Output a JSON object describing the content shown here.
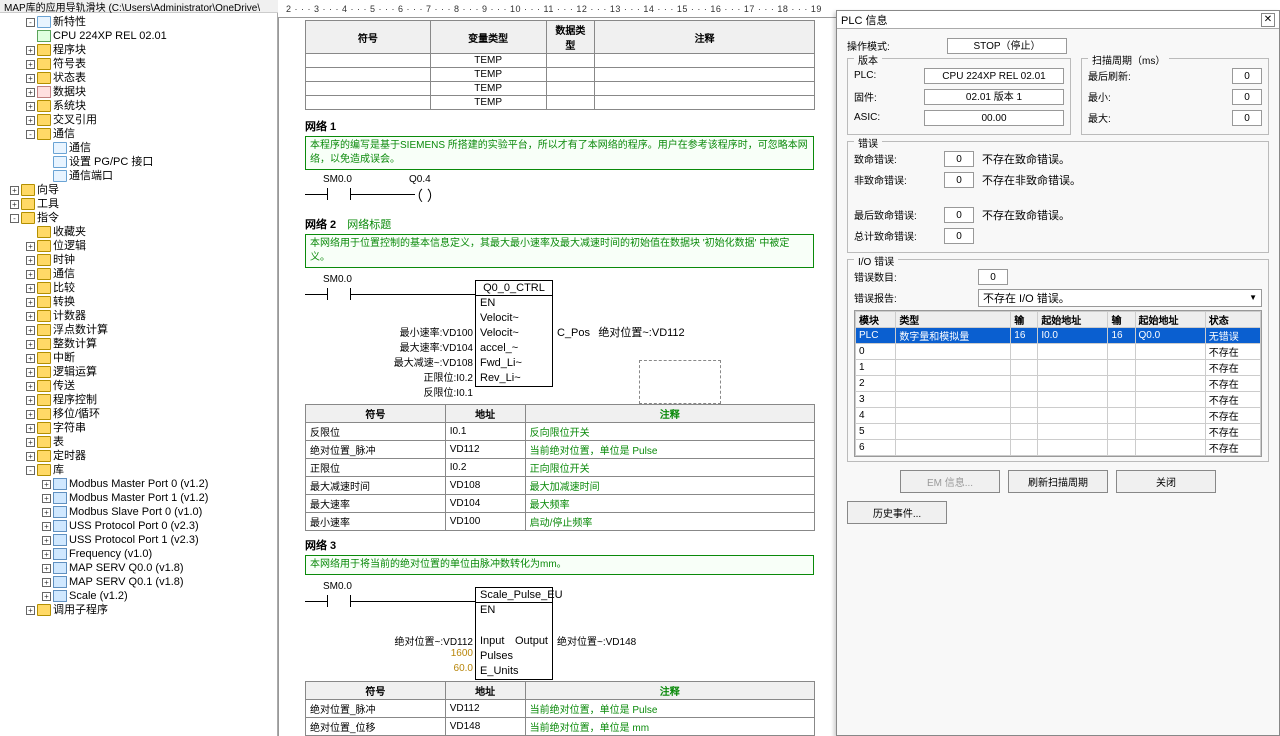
{
  "topbar": {
    "title": "MAP库的应用导轨滑块 (C:\\Users\\Administrator\\OneDrive\\"
  },
  "ruler": "2  · · · 3 · · · 4 · · · 5 · · · 6 · · · 7 · · · 8 · · · 9 · · · 10 · · · 11 · · · 12 · · · 13 · · · 14 · · · 15 · · · 16 · · · 17 · · · 18 · · · 19",
  "tree": [
    {
      "ind": 1,
      "exp": "-",
      "icon": "file",
      "label": "新特性"
    },
    {
      "ind": 1,
      "exp": " ",
      "icon": "chip",
      "label": "CPU 224XP REL 02.01"
    },
    {
      "ind": 1,
      "exp": "+",
      "icon": "folder",
      "label": "程序块"
    },
    {
      "ind": 1,
      "exp": "+",
      "icon": "folder",
      "label": "符号表"
    },
    {
      "ind": 1,
      "exp": "+",
      "icon": "folder",
      "label": "状态表"
    },
    {
      "ind": 1,
      "exp": "+",
      "icon": "block",
      "label": "数据块"
    },
    {
      "ind": 1,
      "exp": "+",
      "icon": "folder",
      "label": "系统块"
    },
    {
      "ind": 1,
      "exp": "+",
      "icon": "folder",
      "label": "交叉引用"
    },
    {
      "ind": 1,
      "exp": "-",
      "icon": "folder",
      "label": "通信"
    },
    {
      "ind": 2,
      "exp": " ",
      "icon": "file",
      "label": "通信"
    },
    {
      "ind": 2,
      "exp": " ",
      "icon": "file",
      "label": "设置 PG/PC 接口"
    },
    {
      "ind": 2,
      "exp": " ",
      "icon": "file",
      "label": "通信端口"
    },
    {
      "ind": 0,
      "exp": "+",
      "icon": "folder",
      "label": "向导"
    },
    {
      "ind": 0,
      "exp": "+",
      "icon": "folder",
      "label": "工具"
    },
    {
      "ind": 0,
      "exp": "-",
      "icon": "folder",
      "label": "指令"
    },
    {
      "ind": 1,
      "exp": " ",
      "icon": "folder",
      "label": "收藏夹"
    },
    {
      "ind": 1,
      "exp": "+",
      "icon": "folder",
      "label": "位逻辑"
    },
    {
      "ind": 1,
      "exp": "+",
      "icon": "folder",
      "label": "时钟"
    },
    {
      "ind": 1,
      "exp": "+",
      "icon": "folder",
      "label": "通信"
    },
    {
      "ind": 1,
      "exp": "+",
      "icon": "folder",
      "label": "比较"
    },
    {
      "ind": 1,
      "exp": "+",
      "icon": "folder",
      "label": "转换"
    },
    {
      "ind": 1,
      "exp": "+",
      "icon": "folder",
      "label": "计数器"
    },
    {
      "ind": 1,
      "exp": "+",
      "icon": "folder",
      "label": "浮点数计算"
    },
    {
      "ind": 1,
      "exp": "+",
      "icon": "folder",
      "label": "整数计算"
    },
    {
      "ind": 1,
      "exp": "+",
      "icon": "folder",
      "label": "中断"
    },
    {
      "ind": 1,
      "exp": "+",
      "icon": "folder",
      "label": "逻辑运算"
    },
    {
      "ind": 1,
      "exp": "+",
      "icon": "folder",
      "label": "传送"
    },
    {
      "ind": 1,
      "exp": "+",
      "icon": "folder",
      "label": "程序控制"
    },
    {
      "ind": 1,
      "exp": "+",
      "icon": "folder",
      "label": "移位/循环"
    },
    {
      "ind": 1,
      "exp": "+",
      "icon": "folder",
      "label": "字符串"
    },
    {
      "ind": 1,
      "exp": "+",
      "icon": "folder",
      "label": "表"
    },
    {
      "ind": 1,
      "exp": "+",
      "icon": "folder",
      "label": "定时器"
    },
    {
      "ind": 1,
      "exp": "-",
      "icon": "folder",
      "label": "库"
    },
    {
      "ind": 2,
      "exp": "+",
      "icon": "lib",
      "label": "Modbus Master Port 0 (v1.2)"
    },
    {
      "ind": 2,
      "exp": "+",
      "icon": "lib",
      "label": "Modbus Master Port 1 (v1.2)"
    },
    {
      "ind": 2,
      "exp": "+",
      "icon": "lib",
      "label": "Modbus Slave Port 0 (v1.0)"
    },
    {
      "ind": 2,
      "exp": "+",
      "icon": "lib",
      "label": "USS Protocol Port 0 (v2.3)"
    },
    {
      "ind": 2,
      "exp": "+",
      "icon": "lib",
      "label": "USS Protocol Port 1 (v2.3)"
    },
    {
      "ind": 2,
      "exp": "+",
      "icon": "lib",
      "label": "Frequency (v1.0)"
    },
    {
      "ind": 2,
      "exp": "+",
      "icon": "lib",
      "label": "MAP SERV Q0.0 (v1.8)"
    },
    {
      "ind": 2,
      "exp": "+",
      "icon": "lib",
      "label": "MAP SERV Q0.1 (v1.8)"
    },
    {
      "ind": 2,
      "exp": "+",
      "icon": "lib",
      "label": "Scale (v1.2)"
    },
    {
      "ind": 1,
      "exp": "+",
      "icon": "folder",
      "label": "调用子程序"
    }
  ],
  "temp_table": {
    "headers": [
      "符号",
      "变量类型",
      "数据类型",
      "注释"
    ],
    "rows": [
      [
        "",
        "TEMP",
        "",
        ""
      ],
      [
        "",
        "TEMP",
        "",
        ""
      ],
      [
        "",
        "TEMP",
        "",
        ""
      ],
      [
        "",
        "TEMP",
        "",
        ""
      ]
    ]
  },
  "net1": {
    "title": "网络 1",
    "comment": "本程序的编写是基于SIEMENS 所搭建的实验平台，所以才有了本网络的程序。用户在参考该程序时，可忽略本网络，以免造成误会。",
    "sym_left": "SM0.0",
    "sym_right": "Q0.4"
  },
  "net2": {
    "title": "网络 2",
    "link": "网络标题",
    "comment": "本网络用于位置控制的基本信息定义，其最大最小速率及最大减速时间的初始值在数据块 '初始化数据' 中被定义。",
    "sym_left": "SM0.0",
    "box_title": "Q0_0_CTRL",
    "box_en": "EN",
    "pins_left": [
      {
        "label": "最小速率:VD100",
        "port": "Velocit~"
      },
      {
        "label": "最大速率:VD104",
        "port": "Velocit~"
      },
      {
        "label": "最大减速~:VD108",
        "port": "accel_~"
      },
      {
        "label": "正限位:I0.2",
        "port": "Fwd_Li~"
      },
      {
        "label": "反限位:I0.1",
        "port": "Rev_Li~"
      }
    ],
    "pins_right": [
      {
        "port": "C_Pos",
        "label": "绝对位置~:VD112"
      }
    ]
  },
  "symtable2": {
    "headers": [
      "符号",
      "地址",
      "注释"
    ],
    "rows": [
      [
        "反限位",
        "I0.1",
        "反向限位开关"
      ],
      [
        "绝对位置_脉冲",
        "VD112",
        "当前绝对位置，单位是 Pulse"
      ],
      [
        "正限位",
        "I0.2",
        "正向限位开关"
      ],
      [
        "最大减速时间",
        "VD108",
        "最大加减速时间"
      ],
      [
        "最大速率",
        "VD104",
        "最大频率"
      ],
      [
        "最小速率",
        "VD100",
        "启动/停止频率"
      ]
    ]
  },
  "net3": {
    "title": "网络 3",
    "comment": "本网络用于将当前的绝对位置的单位由脉冲数转化为mm。",
    "sym_left": "SM0.0",
    "box_title": "Scale_Pulse_EU",
    "box_en": "EN",
    "pin_in_label": "绝对位置~:VD112",
    "pin_in_port": "Input",
    "pin_out_port": "Output",
    "pin_out_label": "绝对位置~:VD148",
    "const1": "1600",
    "const1_port": "Pulses",
    "const2": "60.0",
    "const2_port": "E_Units"
  },
  "symtable3": {
    "headers": [
      "符号",
      "地址",
      "注释"
    ],
    "rows": [
      [
        "绝对位置_脉冲",
        "VD112",
        "当前绝对位置，单位是 Pulse"
      ],
      [
        "绝对位置_位移",
        "VD148",
        "当前绝对位置，单位是 mm"
      ]
    ]
  },
  "panel": {
    "title": "PLC 信息",
    "opmode_label": "操作模式:",
    "opmode_value": "STOP（停止）",
    "version_label": "版本",
    "plc_label": "PLC:",
    "plc_value": "CPU 224XP REL 02.01",
    "fw_label": "固件:",
    "fw_value": "02.01 版本 1",
    "asic_label": "ASIC:",
    "asic_value": "00.00",
    "scan_label": "扫描周期（ms）",
    "last_label": "最后刷新:",
    "last_value": "0",
    "min_label": "最小:",
    "min_value": "0",
    "max_label": "最大:",
    "max_value": "0",
    "err_label": "错误",
    "fatal_label": "致命错误:",
    "fatal_value": "0",
    "fatal_note": "不存在致命错误。",
    "nonfatal_label": "非致命错误:",
    "nonfatal_value": "0",
    "nonfatal_note": "不存在非致命错误。",
    "lastfatal_label": "最后致命错误:",
    "lastfatal_value": "0",
    "lastfatal_note": "不存在致命错误。",
    "totalfatal_label": "总计致命错误:",
    "totalfatal_value": "0",
    "io_label": "I/O 错误",
    "ionum_label": "错误数目:",
    "ionum_value": "0",
    "iorep_label": "错误报告:",
    "iorep_value": "不存在 I/O 错误。",
    "grid_headers": [
      "模块",
      "类型",
      "输",
      "起始地址",
      "输",
      "起始地址",
      "状态"
    ],
    "grid_rows": [
      [
        "PLC",
        "数字量和模拟量",
        "16",
        "I0.0",
        "16",
        "Q0.0",
        "无错误"
      ],
      [
        "0",
        "",
        "",
        "",
        "",
        "",
        "不存在"
      ],
      [
        "1",
        "",
        "",
        "",
        "",
        "",
        "不存在"
      ],
      [
        "2",
        "",
        "",
        "",
        "",
        "",
        "不存在"
      ],
      [
        "3",
        "",
        "",
        "",
        "",
        "",
        "不存在"
      ],
      [
        "4",
        "",
        "",
        "",
        "",
        "",
        "不存在"
      ],
      [
        "5",
        "",
        "",
        "",
        "",
        "",
        "不存在"
      ],
      [
        "6",
        "",
        "",
        "",
        "",
        "",
        "不存在"
      ]
    ],
    "btn_em": "EM 信息...",
    "btn_refresh": "刷新扫描周期",
    "btn_close": "关闭",
    "btn_history": "历史事件..."
  }
}
